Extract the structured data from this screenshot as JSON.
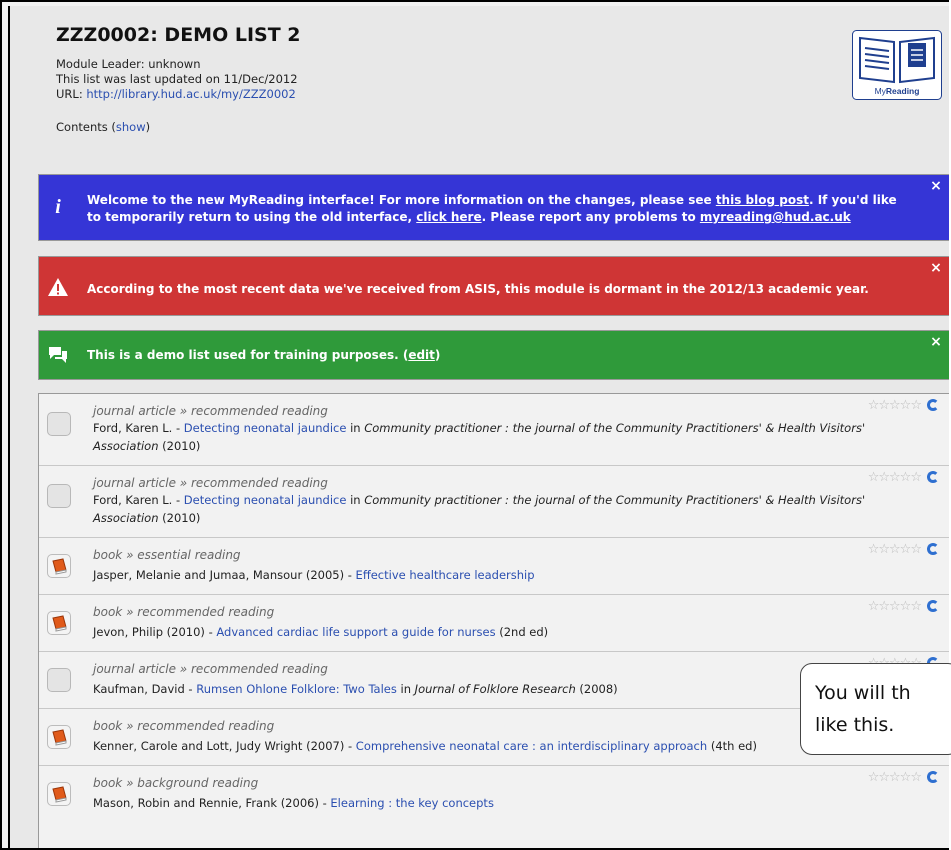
{
  "header": {
    "title": "ZZZ0002: DEMO LIST 2",
    "module_leader": "Module Leader: unknown",
    "updated": "This list was last updated on 11/Dec/2012",
    "url_label": "URL: ",
    "url": "http://library.hud.ac.uk/my/ZZZ0002",
    "contents_label": "Contents (",
    "contents_link": "show",
    "contents_end": ")",
    "logo_text": "MyReading",
    "logo_prefix": "My"
  },
  "alerts": {
    "blue": {
      "t1": "Welcome to the new MyReading interface! For more information on the changes, please see ",
      "l1": "this blog post",
      "t2": ". If you'd like to temporarily return to using the old interface, ",
      "l2": "click here",
      "t3": ". Please report any problems to ",
      "l3": "myreading@hud.ac.uk"
    },
    "red": {
      "text": "According to the most recent data we've received from ASIS, this module is dormant in the 2012/13 academic year."
    },
    "green": {
      "t1": "This is a demo list used for training purposes. (",
      "l1": "edit",
      "t2": ")"
    },
    "close": "×"
  },
  "items": [
    {
      "kind": "journal article » recommended reading",
      "author": "Ford, Karen L. - ",
      "title": "Detecting neonatal jaundice",
      "mid": " in ",
      "source": "Community practitioner : the journal of the Community Practitioners' & Health Visitors' Association",
      "tail": " (2010)"
    },
    {
      "kind": "journal article » recommended reading",
      "author": "Ford, Karen L. - ",
      "title": "Detecting neonatal jaundice",
      "mid": " in ",
      "source": "Community practitioner : the journal of the Community Practitioners' & Health Visitors' Association",
      "tail": " (2010)"
    },
    {
      "kind": "book » essential reading",
      "author": "Jasper, Melanie and Jumaa, Mansour (2005) - ",
      "title": "Effective healthcare leadership",
      "mid": "",
      "source": "",
      "tail": ""
    },
    {
      "kind": "book » recommended reading",
      "author": "Jevon, Philip (2010) - ",
      "title": "Advanced cardiac life support a guide for nurses",
      "mid": "",
      "source": "",
      "tail": " (2nd ed)"
    },
    {
      "kind": "journal article » recommended reading",
      "author": "Kaufman, David - ",
      "title": "Rumsen Ohlone Folklore: Two Tales",
      "mid": " in ",
      "source": "Journal of Folklore Research",
      "tail": " (2008)"
    },
    {
      "kind": "book » recommended reading",
      "author": "Kenner, Carole and Lott, Judy Wright (2007) - ",
      "title": "Comprehensive neonatal care : an interdisciplinary approach",
      "mid": "",
      "source": "",
      "tail": " (4th ed)"
    },
    {
      "kind": "book » background reading",
      "author": "Mason, Robin and Rennie, Frank (2006) - ",
      "title": "Elearning : the key concepts",
      "mid": "",
      "source": "",
      "tail": ""
    }
  ],
  "stars": "☆☆☆☆☆",
  "callout": {
    "line1": "You will th",
    "line2": "like this."
  }
}
